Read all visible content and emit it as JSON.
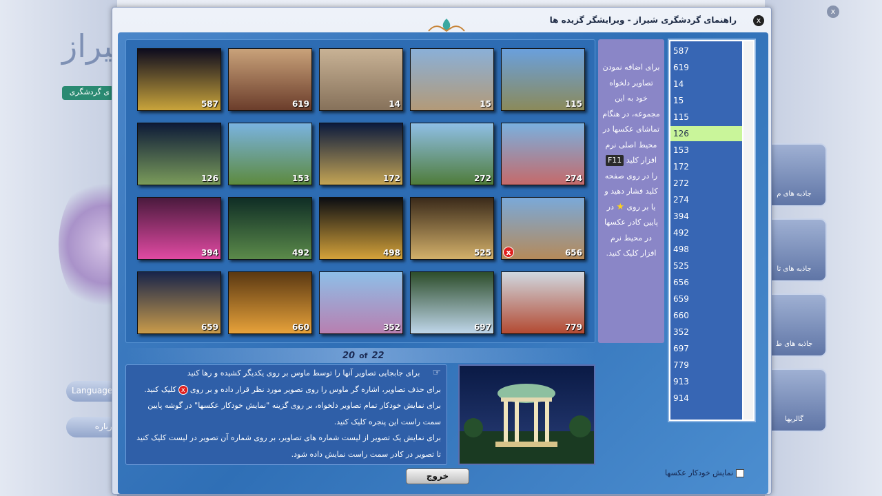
{
  "window": {
    "title": "راهنمای گردشگری شیراز - ویرایشگر گزیده ها",
    "close_glyph": "x"
  },
  "background_app": {
    "tag": "ی گردشگری",
    "language_label": "Language",
    "about_label": "درباره",
    "side_buttons": [
      "جاذبه های م",
      "جاذبه های تا",
      "جاذبه های ط",
      "گالریها"
    ],
    "close_glyph": "x"
  },
  "gallery": {
    "thumbnails": [
      {
        "number": "587",
        "colors": [
          "#0d0b1e",
          "#c9a43b"
        ]
      },
      {
        "number": "619",
        "colors": [
          "#c9a27a",
          "#6b3d2b"
        ]
      },
      {
        "number": "14",
        "colors": [
          "#c8b295",
          "#86715a"
        ]
      },
      {
        "number": "15",
        "colors": [
          "#8ab0d8",
          "#b39a78"
        ]
      },
      {
        "number": "115",
        "colors": [
          "#6aa0dd",
          "#8b8a5a"
        ]
      },
      {
        "number": "126",
        "colors": [
          "#0d1a38",
          "#7a9b5a"
        ]
      },
      {
        "number": "153",
        "colors": [
          "#7ab3e0",
          "#5d8a3e"
        ]
      },
      {
        "number": "172",
        "colors": [
          "#0b1a3d",
          "#c4a454"
        ]
      },
      {
        "number": "272",
        "colors": [
          "#8fbfe6",
          "#4f7c3a"
        ]
      },
      {
        "number": "274",
        "colors": [
          "#7ab0df",
          "#c56a6a"
        ]
      },
      {
        "number": "394",
        "colors": [
          "#4a1a3d",
          "#e04aa2"
        ]
      },
      {
        "number": "492",
        "colors": [
          "#0f2d25",
          "#5b8a4a"
        ]
      },
      {
        "number": "498",
        "colors": [
          "#0b0d12",
          "#d4a23a"
        ]
      },
      {
        "number": "525",
        "colors": [
          "#3a2a1a",
          "#d3b06a"
        ]
      },
      {
        "number": "656",
        "colors": [
          "#7aa9d9",
          "#b58a5a"
        ],
        "has_delete": true
      },
      {
        "number": "659",
        "colors": [
          "#18244a",
          "#c99b4a"
        ]
      },
      {
        "number": "660",
        "colors": [
          "#5a3812",
          "#e7a23a"
        ]
      },
      {
        "number": "352",
        "colors": [
          "#8ebfe8",
          "#b87fb0"
        ]
      },
      {
        "number": "697",
        "colors": [
          "#2d4d2a",
          "#bfd6ea"
        ]
      },
      {
        "number": "779",
        "colors": [
          "#d0d8e0",
          "#b34a32"
        ]
      }
    ],
    "delete_glyph": "x"
  },
  "counter": {
    "current": "20",
    "of": "of",
    "total": "22"
  },
  "instructions": {
    "hand_icon": "☞",
    "line1": "برای جابجایی تصاویر آنها را توسط ماوس بر روی یکدیگر کشیده و رها کنید",
    "line2a": "برای حذف تصاویر، اشاره گر ماوس را روی تصویر مورد نظر قرار داده و بر روی",
    "line2b": "کلیک کنید.",
    "line3": "برای نمایش خودکار تمام تصاویر دلخواه، بر روی گزینه \"نمایش خودکار عکسها\" در گوشه پایین سمت راست این پنجره کلیک کنید.",
    "line4": "برای نمایش یک تصویر از لیست شماره های تصاویر، بر روی شماره آن تصویر در لیست کلیک کنید تا تصویر در کادر سمت راست نمایش داده شود.",
    "x_glyph": "x"
  },
  "help": {
    "text_before_key": "برای اضافه نمودن تصاویر دلخواه خود به این مجموعه، در هنگام تماشای عکسها در محیط اصلی نرم افزار کلید",
    "key": "F11",
    "text_after_key": "را در روی صفحه کلید فشار دهید و یا بر روی",
    "star": "★",
    "text_after_star": "در پایین کادر عکسها در محیط نرم افزار کلیک کنید."
  },
  "number_list": {
    "items": [
      "587",
      "619",
      "14",
      "15",
      "115",
      "126",
      "153",
      "172",
      "272",
      "274",
      "394",
      "492",
      "498",
      "525",
      "656",
      "659",
      "660",
      "352",
      "697",
      "779",
      "913",
      "914"
    ],
    "selected": "126"
  },
  "exit_button": {
    "label": "خروج"
  },
  "autoplay": {
    "label": "نمایش خودکار عکسها"
  }
}
